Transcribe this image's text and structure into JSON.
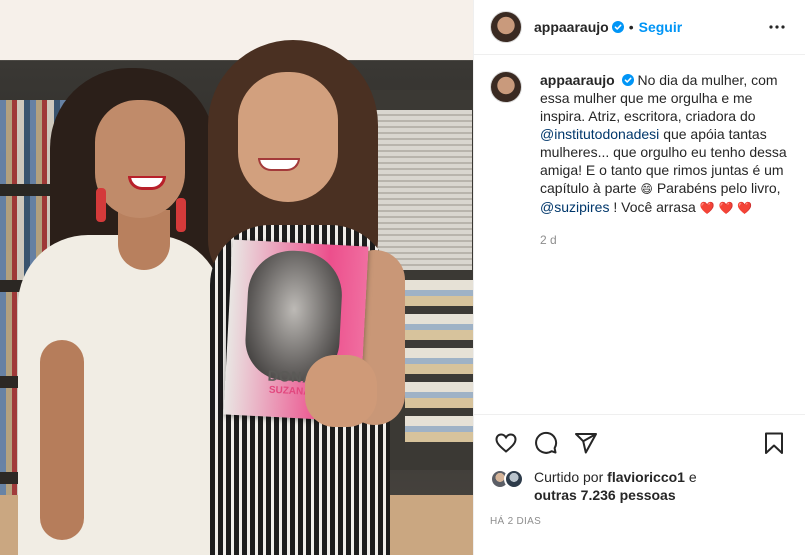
{
  "post": {
    "username": "appaaraujo",
    "follow_label": "Seguir",
    "separator": "•",
    "caption": {
      "username": "appaaraujo",
      "part1": "No dia da mulher, com essa mulher que me orgulha e me inspira. Atriz, escritora, criadora do",
      "mention1": "@institutodonadesi",
      "part2": "que apóia tantas mulheres... que orgulho eu tenho dessa amiga! E o tanto que rimos juntas é um capítulo à parte",
      "emoji": "😄",
      "part3": "Parabéns pelo livro,",
      "mention2": "@suzipires",
      "part4": "! Você arrasa",
      "hearts": "❤️ ❤️ ❤️",
      "relative_time": "2 d"
    },
    "likes": {
      "prefix": "Curtido por",
      "user": "flavioricco1",
      "mid": "e",
      "others": "outras 7.236 pessoas"
    },
    "date_label": "HÁ 2 DIAS"
  },
  "photo": {
    "book_title": "DONA DE",
    "book_subtitle": "SUZANA PIRES"
  },
  "icons": {
    "verified": "verified-badge-icon",
    "more": "more-options-icon",
    "like": "heart-icon",
    "comment": "comment-icon",
    "share": "share-icon",
    "save": "bookmark-icon"
  },
  "colors": {
    "accent": "#0095f6",
    "mention": "#00376b",
    "muted": "#8e8e8e",
    "text": "#262626",
    "heart": "#e0245e"
  }
}
